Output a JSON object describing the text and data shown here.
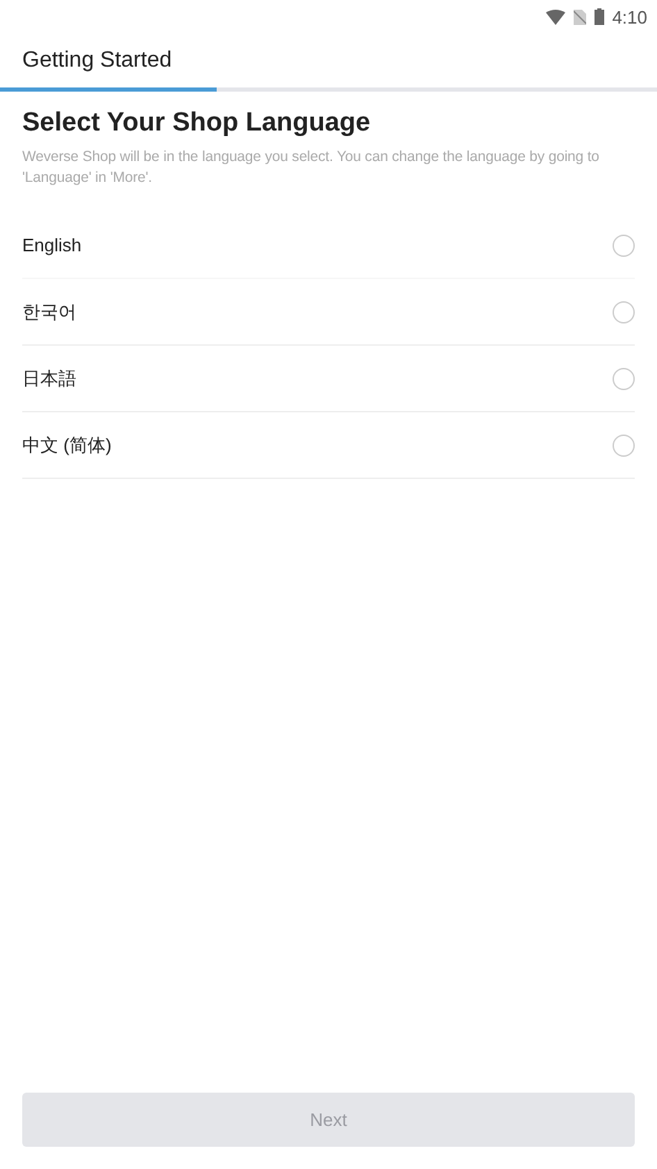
{
  "status_bar": {
    "time": "4:10"
  },
  "app_bar": {
    "title": "Getting Started"
  },
  "progress": {
    "level": 0.33
  },
  "heading": "Select Your Shop Language",
  "description": "Weverse Shop will be in the language you select. You can change the language by going to 'Language' in 'More'.",
  "languages": [
    {
      "label": "English",
      "selected": false
    },
    {
      "label": "한국어",
      "selected": false
    },
    {
      "label": "日本語",
      "selected": false
    },
    {
      "label": "中文 (简体)",
      "selected": false
    }
  ],
  "next_button": {
    "label": "Next",
    "disabled": true
  }
}
